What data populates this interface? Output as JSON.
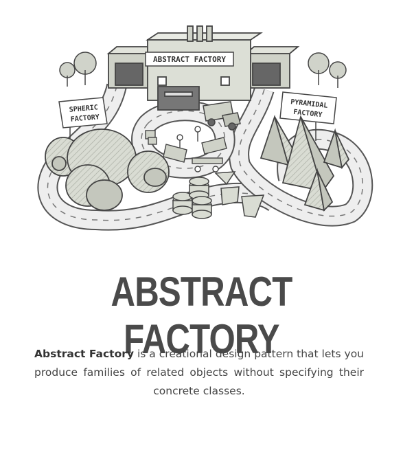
{
  "illustration": {
    "factory_sign": "ABSTRACT FACTORY",
    "spheric_sign_line1": "SPHERIC",
    "spheric_sign_line2": "FACTORY",
    "pyramidal_sign_line1": "PYRAMIDAL",
    "pyramidal_sign_line2": "FACTORY"
  },
  "header": {
    "title": "ABSTRACT FACTORY"
  },
  "intro": {
    "term": "Abstract Factory",
    "rest": " is a creational design pattern that lets you produce families of related objects without specifying their concrete classes."
  }
}
